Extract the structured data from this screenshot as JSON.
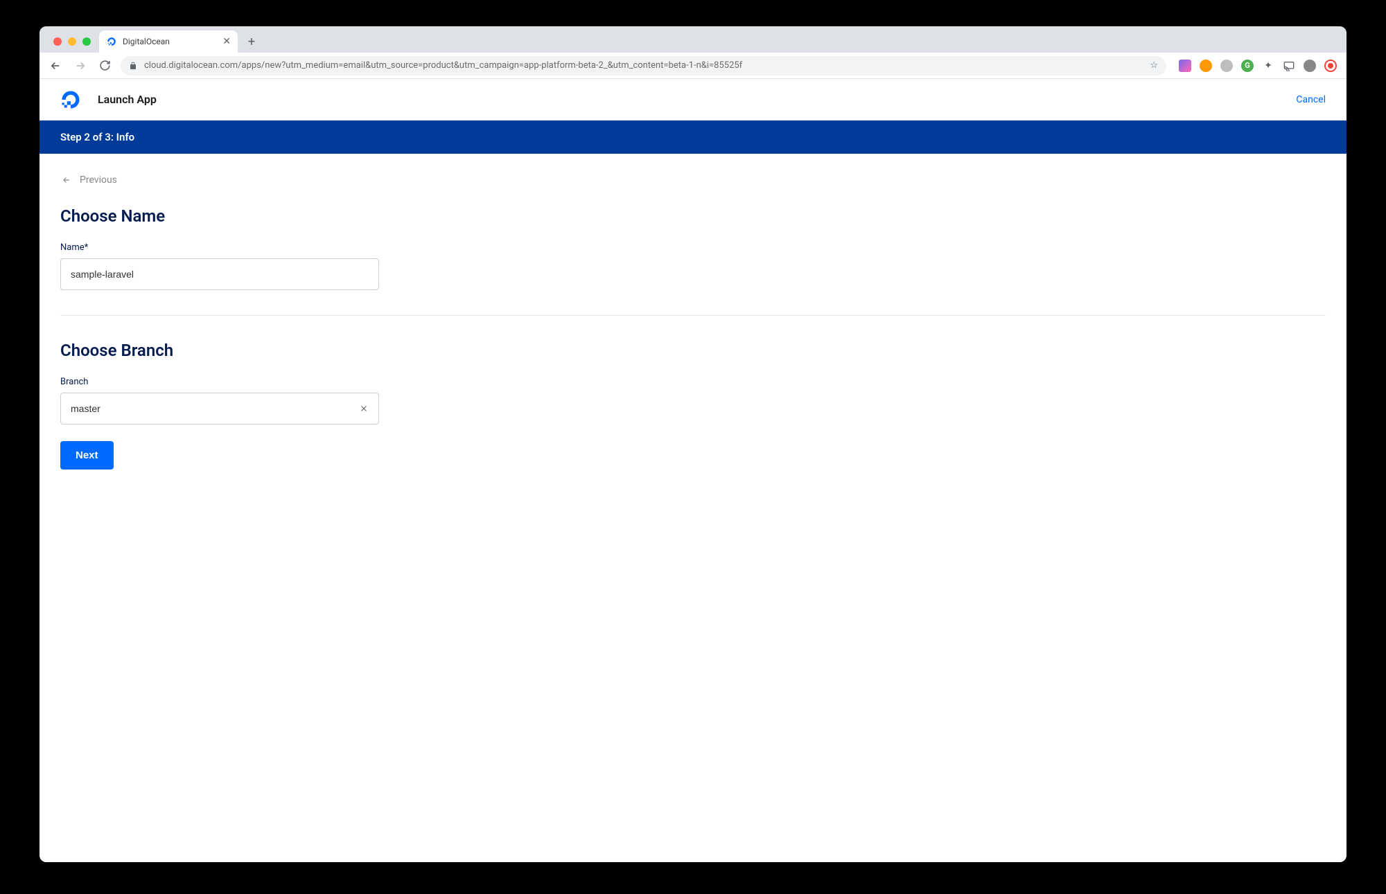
{
  "browser": {
    "tab_title": "DigitalOcean",
    "url": "cloud.digitalocean.com/apps/new?utm_medium=email&utm_source=product&utm_campaign=app-platform-beta-2_&utm_content=beta-1-n&i=85525f"
  },
  "header": {
    "app_title": "Launch App",
    "cancel_label": "Cancel"
  },
  "step_banner": "Step 2 of 3: Info",
  "nav": {
    "previous_label": "Previous"
  },
  "sections": {
    "choose_name": {
      "title": "Choose Name",
      "name_label": "Name",
      "name_required": "*",
      "name_value": "sample-laravel"
    },
    "choose_branch": {
      "title": "Choose Branch",
      "branch_label": "Branch",
      "branch_value": "master"
    }
  },
  "buttons": {
    "next_label": "Next"
  }
}
